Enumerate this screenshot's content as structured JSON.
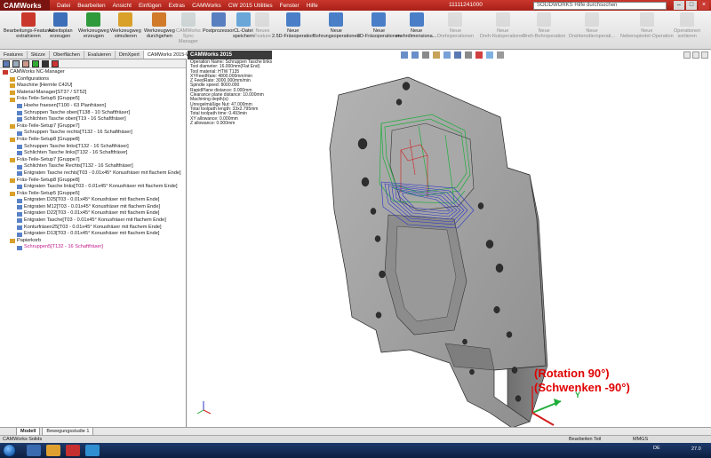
{
  "app": {
    "logo": "CAMWorks",
    "menus": [
      "Datei",
      "Bearbeiten",
      "Ansicht",
      "Einfügen",
      "Extras",
      "CAMWorks",
      "CW 2015 Utilities",
      "Fenster",
      "Hilfe"
    ],
    "document_title": "11111241000",
    "help_search_placeholder": "SOLIDWORKS Hilfe durchsuchen"
  },
  "toolbar": {
    "buttons": [
      {
        "label": "Bearbeitungs-Features\nextrahieren",
        "enabled": true
      },
      {
        "label": "Arbeitsplan\nerzeugen",
        "enabled": true
      },
      {
        "label": "Werkzeugweg\nerzeugen",
        "enabled": true
      },
      {
        "label": "Werkzeugweg\nsimulieren",
        "enabled": true
      },
      {
        "label": "Werkzeugweg\ndurchgehen",
        "enabled": true
      },
      {
        "label": "CAMWorks\nSync\nManager",
        "enabled": false
      },
      {
        "label": "Postprozessor",
        "enabled": true
      },
      {
        "label": "CL-Datei\nspeichern",
        "enabled": true
      },
      {
        "label": "Neues\nFeature",
        "enabled": false
      },
      {
        "label": "Neue\n2.5D-Fräsoperation",
        "enabled": true
      },
      {
        "label": "Neue\nBohrungsoperationen",
        "enabled": true
      },
      {
        "label": "Neue\n3D-Fräsoperationen",
        "enabled": true
      },
      {
        "label": "Neue\nmehrdimensiona...",
        "enabled": true
      },
      {
        "label": "Neue\nDrehoperationen",
        "enabled": false
      },
      {
        "label": "Neue\nDreh-Nutoperationen",
        "enabled": false
      },
      {
        "label": "Neue\nDreh-Bohroperation",
        "enabled": false
      },
      {
        "label": "Neue\nDrahterodieroperati...",
        "enabled": false
      },
      {
        "label": "Neue\nNebenspindel-Operation",
        "enabled": false
      },
      {
        "label": "Operationen\nsortieren",
        "enabled": false
      }
    ]
  },
  "feature_tabs": [
    "Features",
    "Skizze",
    "Oberflächen",
    "Evaluieren",
    "DimXpert",
    "CAMWorks 2015-WorkFlow"
  ],
  "tree": {
    "items": [
      {
        "label": "CAMWorks NC-Manager",
        "depth": 0,
        "color": "normal"
      },
      {
        "label": "Configurations",
        "depth": 1,
        "color": "normal"
      },
      {
        "label": "Maschine [Hermle C42U]",
        "depth": 1,
        "color": "normal"
      },
      {
        "label": "Material-Manager[ST37 / ST52]",
        "depth": 1,
        "color": "normal"
      },
      {
        "label": "Fräs-Teile-Setup5 [Gruppe5]",
        "depth": 1,
        "color": "normal"
      },
      {
        "label": "Hoehe fraesen[T100 - 63 Planfräsen]",
        "depth": 2,
        "color": "normal"
      },
      {
        "label": "Schruppen Tasche oben[T138 - 10 Schaftfräser]",
        "depth": 2,
        "color": "normal"
      },
      {
        "label": "Schlichten Tasche oben[T19 - 16 Schaftfräser]",
        "depth": 2,
        "color": "normal"
      },
      {
        "label": "Fräs-Teile-Setup7 [Gruppe7]",
        "depth": 1,
        "color": "normal"
      },
      {
        "label": "Schruppen Tasche rechts[T132 - 16 Schaftfräser]",
        "depth": 2,
        "color": "normal"
      },
      {
        "label": "Fräs-Teile-Setup8 [Gruppe8]",
        "depth": 1,
        "color": "normal"
      },
      {
        "label": "Schruppen Tasche links[T132 - 16 Schaftfräser]",
        "depth": 2,
        "color": "normal"
      },
      {
        "label": "Schlichten Tasche links[T132 - 16 Schaftfräser]",
        "depth": 2,
        "color": "normal"
      },
      {
        "label": "Fräs-Teile-Setup7 [Gruppe7]",
        "depth": 1,
        "color": "normal"
      },
      {
        "label": "Schlichten Tasche Rechts[T132 - 16 Schaftfräser]",
        "depth": 2,
        "color": "normal"
      },
      {
        "label": "Entgraten Tasche rechts[T03 - 0.01x45° Konusfräser mit flachem Ende]",
        "depth": 2,
        "color": "normal"
      },
      {
        "label": "Fräs-Teile-Setup8 [Gruppe8]",
        "depth": 1,
        "color": "normal"
      },
      {
        "label": "Entgraten Tasche links[T03 - 0.01x45° Konusfräser mit flachem Ende]",
        "depth": 2,
        "color": "normal"
      },
      {
        "label": "Fräs-Teile-Setup5 [Gruppe5]",
        "depth": 1,
        "color": "normal"
      },
      {
        "label": "Entgraten D25[T03 - 0.01x45° Konusfräser mit flachem Ende]",
        "depth": 2,
        "color": "normal"
      },
      {
        "label": "Entgraten M12[T03 - 0.01x45° Konusfräser mit flachem Ende]",
        "depth": 2,
        "color": "normal"
      },
      {
        "label": "Entgraten D22[T03 - 0.01x45° Konusfräser mit flachem Ende]",
        "depth": 2,
        "color": "normal"
      },
      {
        "label": "Entgraten Tasche[T03 - 0.01x45° Konusfräser mit flachem Ende]",
        "depth": 2,
        "color": "normal"
      },
      {
        "label": "Konturfräsen25[T03 - 0.01x45° Konusfräser mit flachem Ende]",
        "depth": 2,
        "color": "normal"
      },
      {
        "label": "Entgraten D13[T03 - 0.01x45° Konusfräser mit flachem Ende]",
        "depth": 2,
        "color": "normal"
      },
      {
        "label": "Papierkorb",
        "depth": 1,
        "color": "normal"
      },
      {
        "label": "Schruppen5[T132 - 16 Schaftfräser]",
        "depth": 2,
        "color": "pink"
      }
    ]
  },
  "viewport": {
    "tab_label": "CAMWorks 2015",
    "op_info": [
      "Operation Name: Schruppen Tasche links",
      "Tool diameter: 16.000mm(Flat End)",
      "Tool material: HTW T135",
      "XYFeedRate: 4800.000mm/min",
      "Z FeedRate: 3000.000mm/min",
      "Spindle speed: 8000.000",
      "RapidPlane distance: 0.000mm",
      "Clearance plane distance: 10.000mm",
      "Machining depth(s):",
      "    Unregelmäßige Nut: 47.000mm",
      "Total toolpath length: 33x2.795mm",
      "Total toolpath time: 0.493min",
      "XY allowance: 0.000mm",
      "Z allowance: 0.000mm"
    ],
    "annotation_line1": "(Rotation 90°)",
    "annotation_line2": "(Schwenken -90°)",
    "axis_label_y": "Y"
  },
  "bottom_tabs": [
    "Modell",
    "Bewegungsstudie 1"
  ],
  "status": {
    "left": "CAMWorks Solids",
    "mode": "Bearbeiten Teil",
    "units": "MMGS"
  },
  "taskbar": {
    "lang": "DE",
    "clock": "27.0"
  },
  "colors": {
    "titlebar": "#b9281f",
    "toolpath_blue": "#2a33c8",
    "toolpath_green": "#1fae3b",
    "annotation": "#e00000",
    "part_gray": "#9a9a9a"
  }
}
